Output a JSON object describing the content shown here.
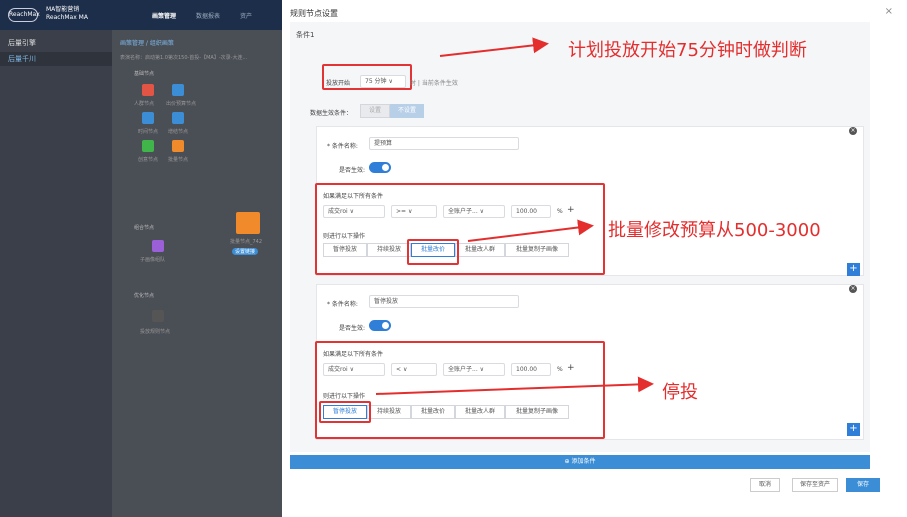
{
  "app": {
    "logo": "ReachMax",
    "brand_line1": "MA智能营销",
    "brand_line2": "ReachMax MA",
    "nav": [
      "画策管理",
      "数据报表",
      "资产"
    ]
  },
  "sidebar": {
    "section": "后量引擎",
    "item": "后量千川"
  },
  "background": {
    "breadcrumb": "画策管理 / 组织画策",
    "desc": "表演名称：启动第1.0第次150-首投-【MA】-次录-大连...",
    "base_nodes": "基础节点",
    "node_labels": [
      "人群节点",
      "出价预算节点",
      "时间节点",
      "增结节点",
      "创意节点",
      "批量节点"
    ],
    "combo": "组合节点",
    "combo_item": "子画像组队",
    "opt": "优化节点",
    "opt_item": "投放规则节点",
    "floating_label": "批量节点_742",
    "floating_btn": "设置链接"
  },
  "modal": {
    "title": "规则节点设置",
    "close": "×",
    "condition_title": "条件1",
    "launch_prefix": "投放开始",
    "launch_value": "75 分钟",
    "launch_suffix": "时 | 当前条件生效",
    "data_effect_label": "数据生效条件：",
    "data_effect_opts": [
      "设置",
      "不设置"
    ],
    "card1": {
      "name_label": "* 条件名称:",
      "name_value": "提预算",
      "effect_label": "是否生效:",
      "if_all": "如果满足以下所有条件",
      "metric": "成交roi",
      "op": ">=",
      "scope": "全账户子...",
      "value": "100.00",
      "unit": "%",
      "then": "则进行以下操作",
      "actions": [
        "暂停投放",
        "持续投放",
        "批量改价",
        "批量改人群",
        "批量复制子画像"
      ]
    },
    "card2": {
      "name_label": "* 条件名称:",
      "name_value": "暂停投放",
      "effect_label": "是否生效:",
      "if_all": "如果满足以下所有条件",
      "metric": "成交roi",
      "op": "<",
      "scope": "全账户子...",
      "value": "100.00",
      "unit": "%",
      "then": "则进行以下操作",
      "actions": [
        "暂停投放",
        "持续投放",
        "批量改价",
        "批量改人群",
        "批量复制子画像"
      ]
    },
    "add_condition": "⊕ 添加条件",
    "footer": {
      "cancel": "取消",
      "save_asset": "保存至资产",
      "save": "保存"
    }
  },
  "annotations": {
    "a1": "计划投放开始75分钟时做判断",
    "a2": "批量修改预算从500-3000",
    "a3": "停投"
  },
  "colors": {
    "accent": "#2f7fd8",
    "annotation": "#e42e2e"
  }
}
